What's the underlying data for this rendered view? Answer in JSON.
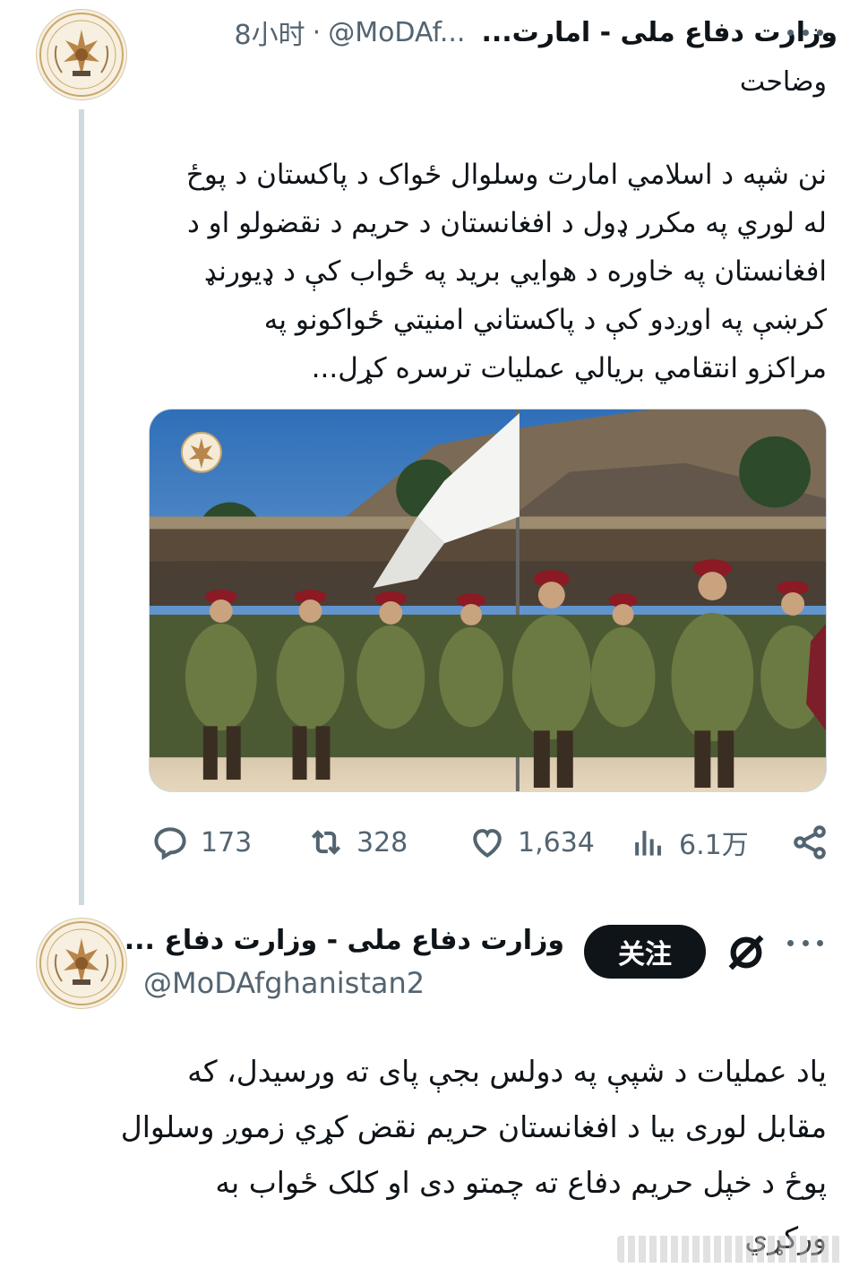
{
  "tweets": [
    {
      "display_name": "وزارت دفاع ملی - امارت...",
      "handle": "@MoDAf...",
      "dot": "·",
      "time": "8小时",
      "subtitle": "وضاحت",
      "body_lines": [
        "نن شپه د اسلامي امارت وسلوال ځواک د پاکستان د پوځ",
        "له لوري په مکرر ډول د افغانستان د حریم د نقضولو او د",
        "افغانستان په خاوره د هوايي برید په ځواب کې د ډیورنډ",
        "کرښې په اوږدو کې د پاکستاني امنیتي ځواکونو په",
        "مراکزو انتقامي بریالي عملیات ترسره کړل..."
      ],
      "media_icon": "military-parade-photo",
      "actions": {
        "reply": "173",
        "retweet": "328",
        "like": "1,634",
        "views": "6.1万"
      }
    },
    {
      "display_name": "وزارت دفاع ملی - وزارت دفاع ...",
      "handle": "@MoDAfghanistan2",
      "follow_label": "关注",
      "body_lines": [
        "یاد عملیات د شپې په دولس بجې پای ته ورسیدل، که",
        "مقابل لوری بیا د افغانستان حریم نقض کړي زموږ وسلوال",
        "پوځ د خپل حریم دفاع ته چمتو دی او کلک ځواب به",
        "ورکړي"
      ]
    }
  ],
  "colors": {
    "text": "#0f1419",
    "secondary": "#536471",
    "thread_line": "#cfd9de",
    "follow_bg": "#0f1419"
  }
}
